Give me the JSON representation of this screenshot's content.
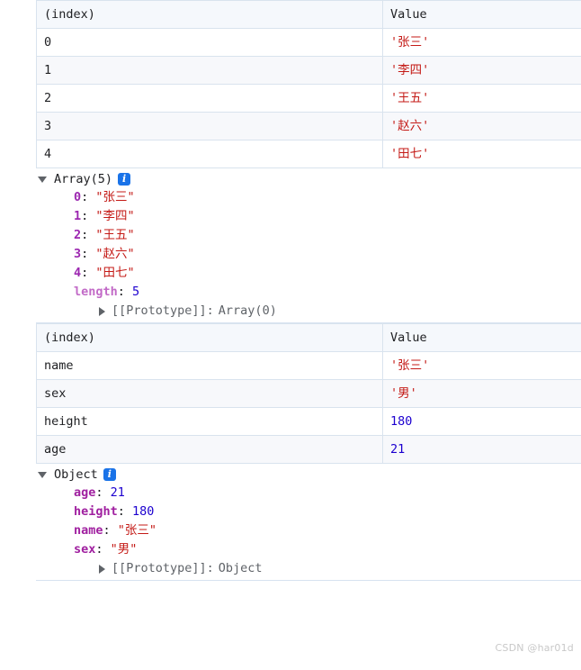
{
  "colors": {
    "string": "#c41a16",
    "number": "#1c00cf",
    "key_index": "#9c27b0",
    "key_prop": "#a020a0",
    "key_length": "#c26ac7",
    "badge_blue": "#1a73e8",
    "table_border": "#d9e3ee",
    "header_bg": "#f5f8fc",
    "stripe_bg": "#f7f8fb",
    "divider": "#d7e3f0",
    "watermark": "#c8c8c8"
  },
  "entries": [
    {
      "id": "array-entry",
      "table": {
        "columns": [
          "(index)",
          "Value"
        ],
        "rows": [
          {
            "index": "0",
            "value": "'张三'",
            "type": "string"
          },
          {
            "index": "1",
            "value": "'李四'",
            "type": "string"
          },
          {
            "index": "2",
            "value": "'王五'",
            "type": "string"
          },
          {
            "index": "3",
            "value": "'赵六'",
            "type": "string"
          },
          {
            "index": "4",
            "value": "'田七'",
            "type": "string"
          }
        ]
      },
      "tree": {
        "expanded": true,
        "toggle_icon": "triangle-down-icon",
        "label": "Array(5)",
        "info_icon": "info-icon",
        "info_glyph": "i",
        "properties": [
          {
            "key": "0",
            "key_style": "index",
            "sep": ": ",
            "value": "\"张三\"",
            "type": "string"
          },
          {
            "key": "1",
            "key_style": "index",
            "sep": ": ",
            "value": "\"李四\"",
            "type": "string"
          },
          {
            "key": "2",
            "key_style": "index",
            "sep": ": ",
            "value": "\"王五\"",
            "type": "string"
          },
          {
            "key": "3",
            "key_style": "index",
            "sep": ": ",
            "value": "\"赵六\"",
            "type": "string"
          },
          {
            "key": "4",
            "key_style": "index",
            "sep": ": ",
            "value": "\"田七\"",
            "type": "string"
          },
          {
            "key": "length",
            "key_style": "length",
            "sep": ": ",
            "value": "5",
            "type": "number"
          }
        ],
        "prototype": {
          "toggle_icon": "triangle-right-icon",
          "label": "[[Prototype]]: ",
          "value": "Array(0)"
        }
      }
    },
    {
      "id": "object-entry",
      "table": {
        "columns": [
          "(index)",
          "Value"
        ],
        "rows": [
          {
            "index": "name",
            "value": "'张三'",
            "type": "string"
          },
          {
            "index": "sex",
            "value": "'男'",
            "type": "string"
          },
          {
            "index": "height",
            "value": "180",
            "type": "number"
          },
          {
            "index": "age",
            "value": "21",
            "type": "number"
          }
        ]
      },
      "tree": {
        "expanded": true,
        "toggle_icon": "triangle-down-icon",
        "label": "Object",
        "info_icon": "info-icon",
        "info_glyph": "i",
        "properties": [
          {
            "key": "age",
            "key_style": "prop",
            "sep": ": ",
            "value": "21",
            "type": "number"
          },
          {
            "key": "height",
            "key_style": "prop",
            "sep": ": ",
            "value": "180",
            "type": "number"
          },
          {
            "key": "name",
            "key_style": "prop",
            "sep": ": ",
            "value": "\"张三\"",
            "type": "string"
          },
          {
            "key": "sex",
            "key_style": "prop",
            "sep": ": ",
            "value": "\"男\"",
            "type": "string"
          }
        ],
        "prototype": {
          "toggle_icon": "triangle-right-icon",
          "label": "[[Prototype]]: ",
          "value": "Object"
        }
      }
    }
  ],
  "watermark": "CSDN @har01d"
}
